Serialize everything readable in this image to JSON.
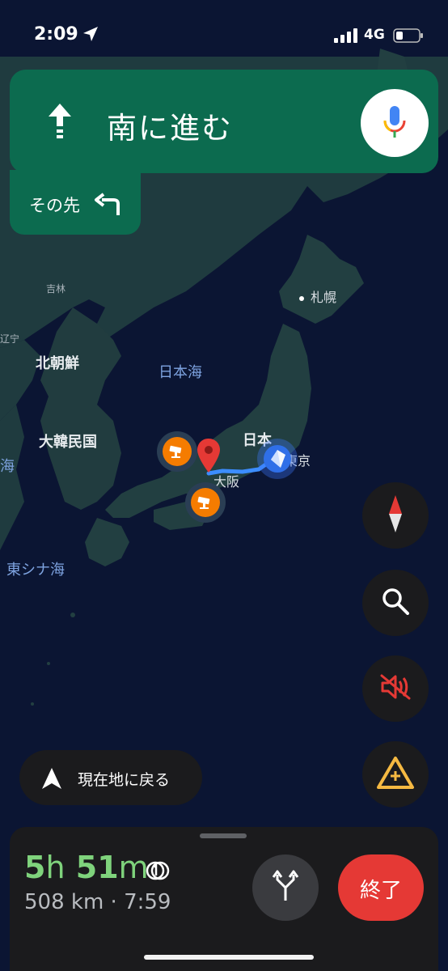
{
  "status_bar": {
    "time": "2:09",
    "network": "4G"
  },
  "navigation": {
    "instruction": "南に進む",
    "then_label": "その先",
    "colors": {
      "banner": "#0c6b4f",
      "eta": "#7fd37c",
      "end": "#e53935"
    }
  },
  "map": {
    "labels": {
      "jilin": "吉林",
      "liaoning": "辽宁",
      "sapporo": "札幌",
      "north_korea": "北朝鮮",
      "sea_of_japan": "日本海",
      "south_korea": "大韓民国",
      "yellow_sea": "海",
      "japan": "日本",
      "tokyo": "東京",
      "osaka": "大阪",
      "east_china_sea": "東シナ海"
    }
  },
  "controls": {
    "recenter_label": "現在地に戻る"
  },
  "trip": {
    "eta_hours": "5",
    "eta_hours_unit": "h",
    "eta_minutes": "51",
    "eta_minutes_unit": "m",
    "details": "508 km · 7:59",
    "end_label": "終了"
  },
  "icons": [
    "location-arrow-icon",
    "up-arrow-icon",
    "mic-icon",
    "turn-left-icon",
    "speed-camera-icon",
    "destination-pin-icon",
    "current-location-icon",
    "compass-icon",
    "search-icon",
    "mute-icon",
    "report-incident-icon",
    "navigate-arrow-icon",
    "loop-icon",
    "alternate-routes-icon"
  ]
}
